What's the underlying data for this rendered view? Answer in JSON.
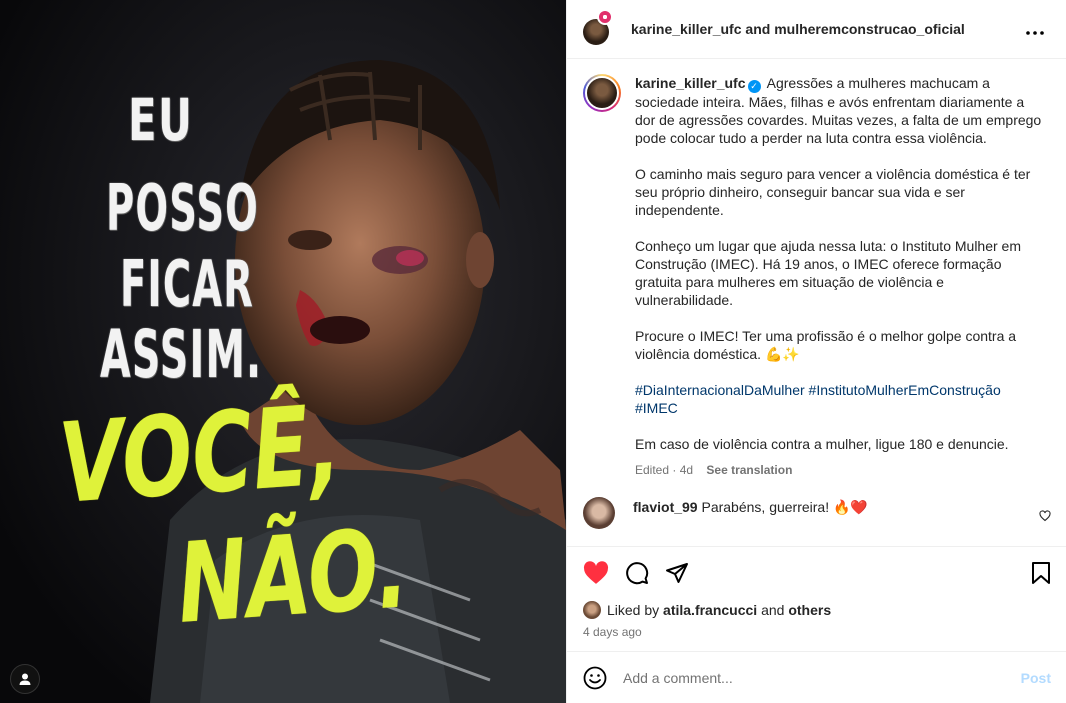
{
  "poster": {
    "line1": "EU",
    "line2": "POSSO",
    "line3": "FICAR",
    "line4": "ASSIM.",
    "yellow1": "VOCÊ,",
    "yellow2": "NÃO."
  },
  "header": {
    "user1": "karine_killer_ufc",
    "and": "and",
    "user2": "mulheremconstrucao_oficial",
    "more_icon": "more-horizontal-icon"
  },
  "caption": {
    "username": "karine_killer_ufc",
    "para1": "Agressões a mulheres machucam a sociedade inteira. Mães, filhas e avós enfrentam diariamente a dor de agressões covardes. Muitas vezes, a falta de um emprego pode colocar tudo a perder na luta contra essa violência.",
    "para2": "O caminho mais seguro para vencer a violência doméstica é ter seu próprio dinheiro, conseguir bancar sua vida e ser independente.",
    "para3": "Conheço um lugar que ajuda nessa luta: o Instituto Mulher em Construção (IMEC). Há 19 anos, o IMEC oferece formação gratuita para mulheres em situação de violência e vulnerabilidade.",
    "para4": "Procure o IMEC! Ter uma profissão é o melhor golpe contra a violência doméstica. 💪✨",
    "hashtag1": "#DiaInternacionalDaMulher",
    "hashtag2": "#InstitutoMulherEmConstrução",
    "hashtag3": "#IMEC",
    "para5": "Em caso de violência contra a mulher, ligue 180 e denuncie.",
    "edited": "Edited · 4d",
    "see_translation": "See translation"
  },
  "comment": {
    "username": "flaviot_99",
    "text": "Parabéns, guerreira! 🔥❤️"
  },
  "likes": {
    "prefix": "Liked by",
    "user": "atila.francucci",
    "and": "and",
    "others": "others",
    "date": "4 days ago"
  },
  "add_comment": {
    "placeholder": "Add a comment...",
    "post_label": "Post"
  },
  "colors": {
    "like_red": "#ff3040",
    "link_blue": "#00376b",
    "verified_blue": "#0095f6",
    "poster_yellow": "#dff23a"
  }
}
